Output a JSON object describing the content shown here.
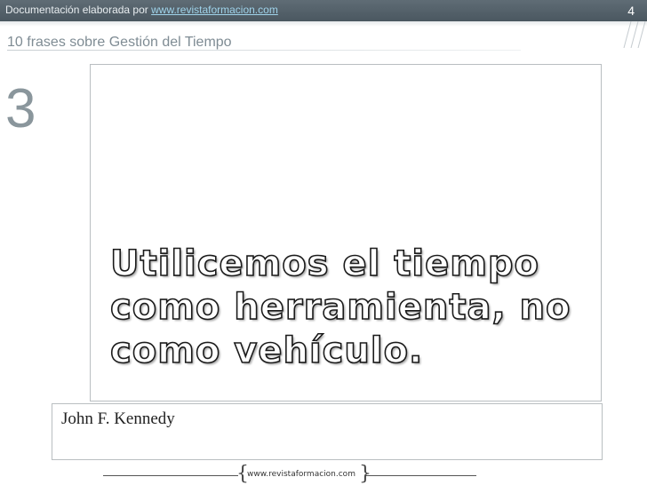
{
  "header": {
    "credit_text": "Documentación elaborada por ",
    "credit_link": "www.revistaformacion.com",
    "page_number": "4"
  },
  "subtitle": "10 frases sobre Gestión del Tiempo",
  "slide_number": "3",
  "quote": "Utilicemos el tiempo como herramienta, no como vehículo.",
  "author": "John F. Kennedy",
  "footer": {
    "url": "www.revistaformacion.com"
  },
  "colors": {
    "topbar": "#56636c",
    "link": "#9fd3ea",
    "accent_gray": "#8a969c"
  }
}
